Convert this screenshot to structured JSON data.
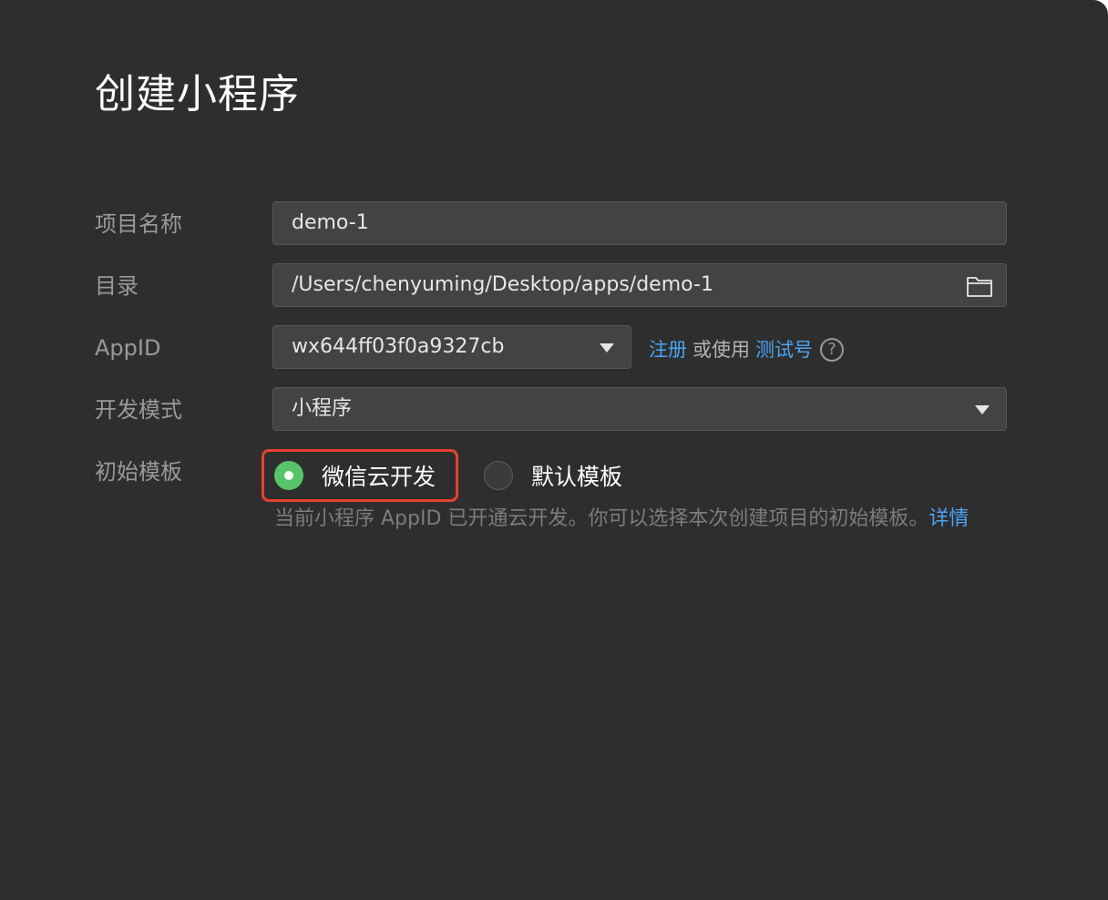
{
  "dialog": {
    "title": "创建小程序"
  },
  "form": {
    "project_name": {
      "label": "项目名称",
      "value": "demo-1"
    },
    "directory": {
      "label": "目录",
      "value": "/Users/chenyuming/Desktop/apps/demo-1",
      "icon": "folder-icon"
    },
    "appid": {
      "label": "AppID",
      "value": "wx644ff03f0a9327cb",
      "register_link": "注册",
      "or_use_text": "或使用",
      "test_account_link": "测试号",
      "help_symbol": "?"
    },
    "dev_mode": {
      "label": "开发模式",
      "value": "小程序"
    },
    "template": {
      "label": "初始模板",
      "options": [
        {
          "label": "微信云开发",
          "selected": true
        },
        {
          "label": "默认模板",
          "selected": false
        }
      ],
      "hint_text": "当前小程序 AppID 已开通云开发。你可以选择本次创建项目的初始模板。",
      "details_link": "详情"
    }
  },
  "colors": {
    "background": "#2e2e2e",
    "link": "#4aa3f5",
    "radio_selected": "#58c46a",
    "highlight_border": "#e8402f"
  }
}
